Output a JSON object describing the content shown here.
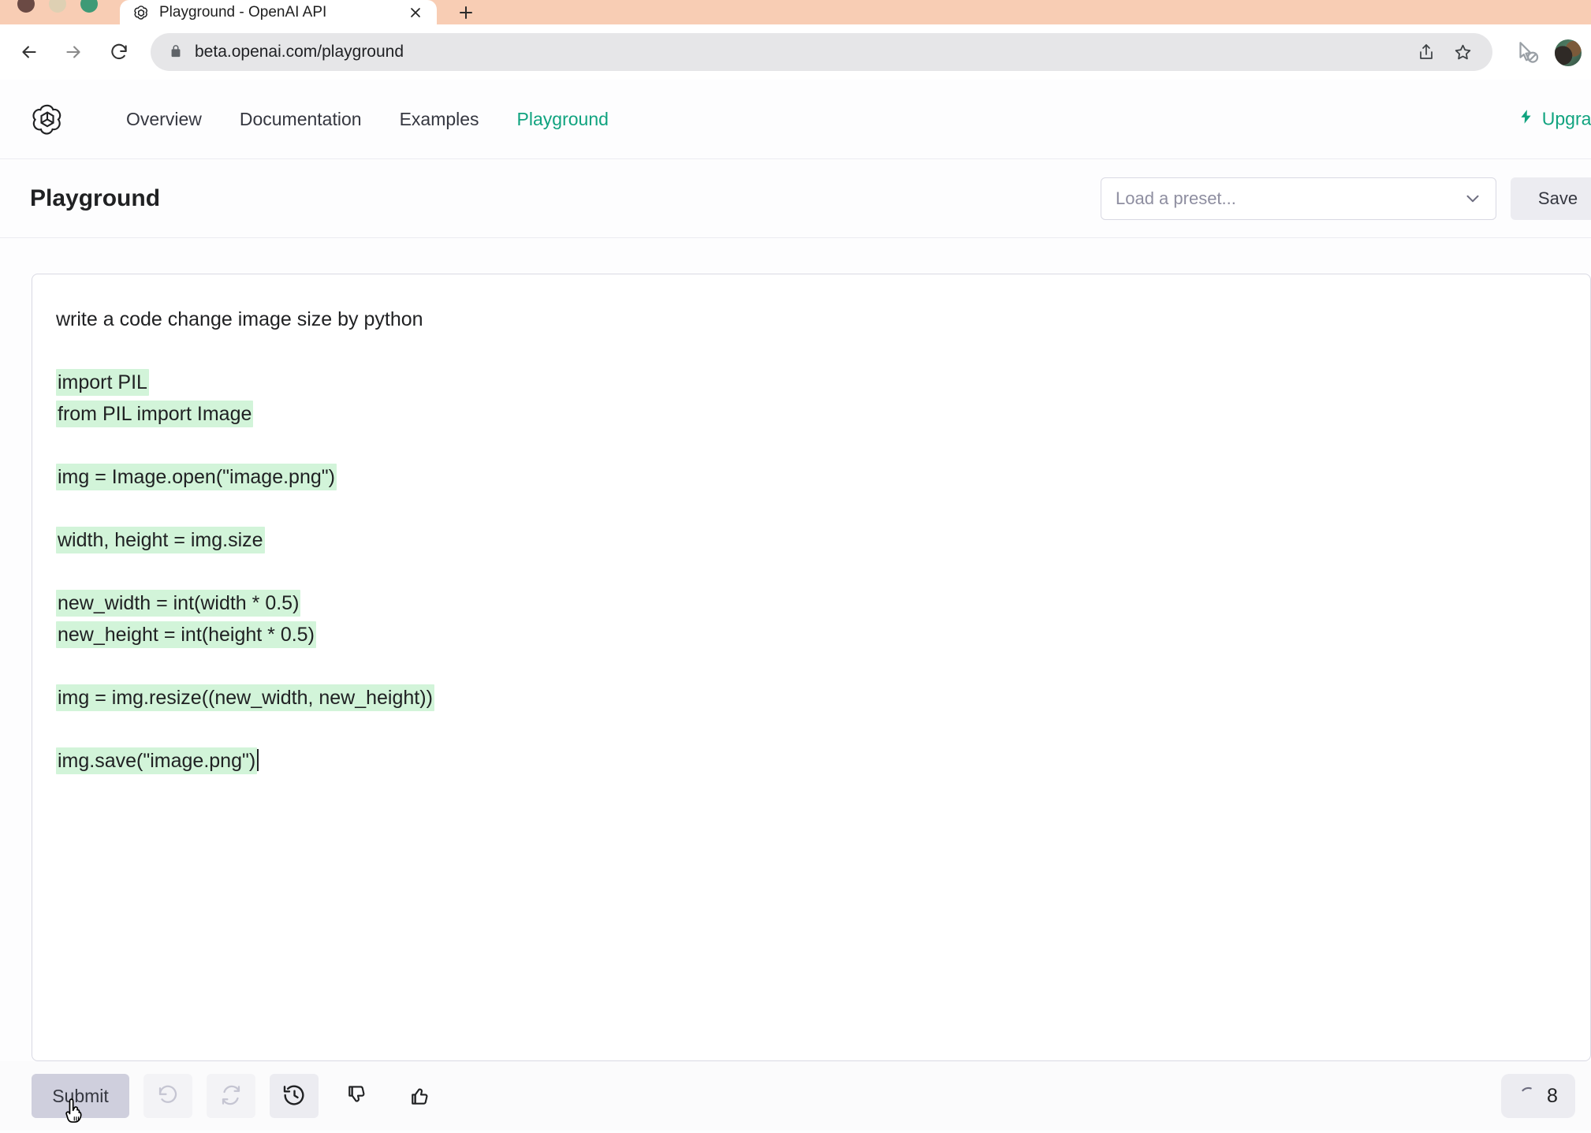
{
  "browser": {
    "tab": {
      "title": "Playground - OpenAI API",
      "favicon_name": "openai-logo-icon",
      "close_label": "×"
    },
    "newtab_label": "+",
    "nav": {
      "back_label": "←",
      "forward_label": "→",
      "reload_label": "↻"
    },
    "omnibox": {
      "url": "beta.openai.com/playground",
      "lock_icon": "lock-icon",
      "share_icon": "share-icon",
      "bookmark_icon": "star-icon"
    },
    "extension_icon": "cursor-blocked-icon",
    "avatar_label": ""
  },
  "site_nav": {
    "logo_name": "openai-logo-icon",
    "links": [
      {
        "label": "Overview",
        "active": false
      },
      {
        "label": "Documentation",
        "active": false
      },
      {
        "label": "Examples",
        "active": false
      },
      {
        "label": "Playground",
        "active": true
      }
    ],
    "upgrade": {
      "label": "Upgrade",
      "icon": "lightning-bolt-icon",
      "color": "#10a37f"
    }
  },
  "page_header": {
    "title": "Playground",
    "preset": {
      "placeholder": "Load a preset...",
      "value": "",
      "chevron_icon": "chevron-down-icon"
    },
    "save_label": "Save"
  },
  "editor": {
    "prompt": "write a code change image size by python",
    "completion_lines": [
      {
        "text": "import PIL",
        "highlight": true
      },
      {
        "text": "from PIL import Image",
        "highlight": true
      },
      {
        "text": "",
        "highlight": false
      },
      {
        "text": "img = Image.open(\"image.png\")",
        "highlight": true
      },
      {
        "text": "",
        "highlight": false
      },
      {
        "text": "width, height = img.size",
        "highlight": true
      },
      {
        "text": "",
        "highlight": false
      },
      {
        "text": "new_width = int(width * 0.5)",
        "highlight": true
      },
      {
        "text": "new_height = int(height * 0.5)",
        "highlight": true
      },
      {
        "text": "",
        "highlight": false
      },
      {
        "text": "img = img.resize((new_width, new_height))",
        "highlight": true
      },
      {
        "text": "",
        "highlight": false
      },
      {
        "text": "img.save(\"image.png\")",
        "highlight": true
      }
    ],
    "highlight_color": "#d2f4d9"
  },
  "bottom_bar": {
    "submit_label": "Submit",
    "icons": [
      {
        "name": "undo-icon",
        "state": "disabled"
      },
      {
        "name": "regenerate-icon",
        "state": "disabled"
      },
      {
        "name": "history-icon",
        "state": "active"
      },
      {
        "name": "thumbs-down-icon",
        "state": "normal"
      },
      {
        "name": "thumbs-up-icon",
        "state": "normal"
      }
    ],
    "token_badge": {
      "count": "8",
      "icon": "spinner-arc-icon"
    }
  }
}
